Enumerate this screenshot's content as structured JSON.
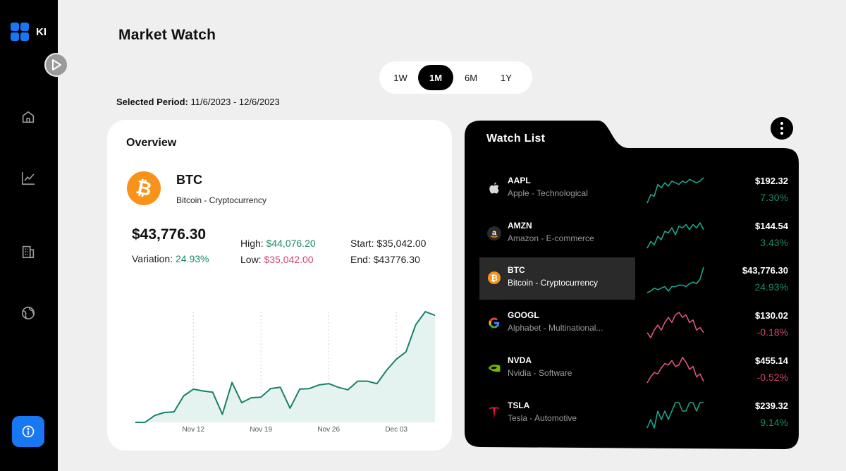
{
  "app": {
    "logo_text": "KI"
  },
  "header": {
    "title": "Market Watch"
  },
  "periods": {
    "options": [
      "1W",
      "1M",
      "6M",
      "1Y"
    ],
    "active": "1M",
    "selected_label": "Selected Period:",
    "selected_range": "11/6/2023 - 12/6/2023"
  },
  "overview": {
    "title": "Overview",
    "symbol": "BTC",
    "name": "Bitcoin - Cryptocurrency",
    "logo_glyph": "₿",
    "price": "$43,776.30",
    "variation_label": "Variation:",
    "variation_value": "24.93%",
    "high_label": "High:",
    "high_value": "$44,076.20",
    "low_label": "Low:",
    "low_value": "$35,042.00",
    "start": "Start: $35,042.00",
    "end": "End: $43776.30"
  },
  "chart_data": {
    "type": "area",
    "title": "",
    "xlabel": "",
    "ylabel": "",
    "x_ticks": [
      "Nov 12",
      "Nov 19",
      "Nov 26",
      "Dec 03"
    ],
    "x_tick_day_index": [
      6,
      13,
      20,
      27
    ],
    "values": [
      35042,
      35050,
      35600,
      35850,
      35900,
      37200,
      37750,
      37600,
      37500,
      35700,
      38300,
      36650,
      37050,
      37100,
      37800,
      37900,
      36200,
      37750,
      37800,
      38100,
      38200,
      37900,
      37700,
      38400,
      38400,
      38200,
      39300,
      40200,
      40800,
      43000,
      44076,
      43776
    ],
    "ylim": [
      35042,
      44076
    ],
    "grid": "vertical dashed at ticks",
    "line_color": "#18806a",
    "fill_color": "#e4f3ef"
  },
  "watchlist": {
    "title": "Watch List",
    "items": [
      {
        "symbol": "AAPL",
        "name": "Apple - Technological",
        "price": "$192.32",
        "change": "7.30%",
        "trend": "up",
        "icon": "apple-icon",
        "spark": [
          4,
          9,
          8,
          15,
          13,
          16,
          14,
          17,
          16,
          15,
          17,
          16,
          18,
          17,
          16,
          17,
          19
        ]
      },
      {
        "symbol": "AMZN",
        "name": "Amazon - E-commerce",
        "price": "$144.54",
        "change": "3.43%",
        "trend": "up",
        "icon": "amazon-icon",
        "spark": [
          3,
          7,
          5,
          10,
          8,
          13,
          12,
          15,
          11,
          16,
          15,
          17,
          14,
          17,
          15,
          18,
          14
        ]
      },
      {
        "symbol": "BTC",
        "name": "Bitcoin - Cryptocurrency",
        "price": "$43,776.30",
        "change": "24.93%",
        "trend": "up",
        "icon": "bitcoin-icon",
        "selected": true,
        "spark": [
          3,
          4,
          6,
          5,
          6,
          7,
          4,
          7,
          7,
          8,
          8,
          7,
          9,
          10,
          9,
          12,
          20
        ]
      },
      {
        "symbol": "GOOGL",
        "name": "Alphabet - Multinational...",
        "price": "$130.02",
        "change": "-0.18%",
        "trend": "down",
        "icon": "google-icon",
        "spark": [
          6,
          4,
          7,
          9,
          7,
          10,
          12,
          10,
          13,
          14,
          12,
          13,
          10,
          11,
          7,
          8,
          6
        ]
      },
      {
        "symbol": "NVDA",
        "name": "Nvidia - Software",
        "price": "$455.14",
        "change": "-0.52%",
        "trend": "down",
        "icon": "nvidia-icon",
        "spark": [
          2,
          6,
          9,
          8,
          12,
          15,
          14,
          17,
          13,
          14,
          19,
          16,
          11,
          13,
          6,
          8,
          3
        ]
      },
      {
        "symbol": "TSLA",
        "name": "Tesla - Automotive",
        "price": "$239.32",
        "change": "9.14%",
        "trend": "up",
        "icon": "tesla-icon",
        "spark": [
          4,
          5,
          4,
          6,
          5,
          6,
          5,
          6,
          7,
          7,
          6,
          6,
          7,
          7,
          6,
          7,
          7
        ]
      }
    ]
  },
  "colors": {
    "up": "#18896a",
    "down": "#d4456e",
    "accent": "#1877f2"
  }
}
